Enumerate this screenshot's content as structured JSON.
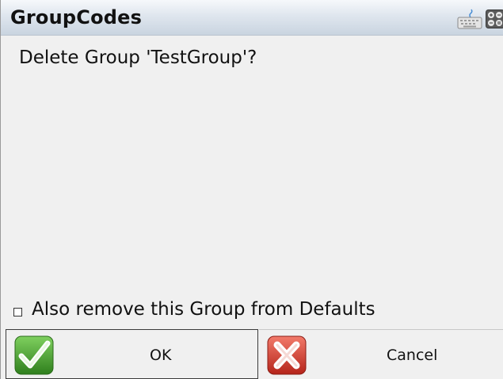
{
  "window": {
    "title": "GroupCodes"
  },
  "titlebar_icons": [
    "keyboard-icon",
    "calculator-icon"
  ],
  "dialog": {
    "message": "Delete Group 'TestGroup'?",
    "checkbox": {
      "label": "Also remove this Group from Defaults",
      "checked": false
    }
  },
  "buttons": {
    "ok": {
      "label": "OK",
      "icon": "green-checkmark-icon",
      "color": "#3f9a2c"
    },
    "cancel": {
      "label": "Cancel",
      "icon": "red-x-icon",
      "color": "#d43a2f"
    }
  }
}
